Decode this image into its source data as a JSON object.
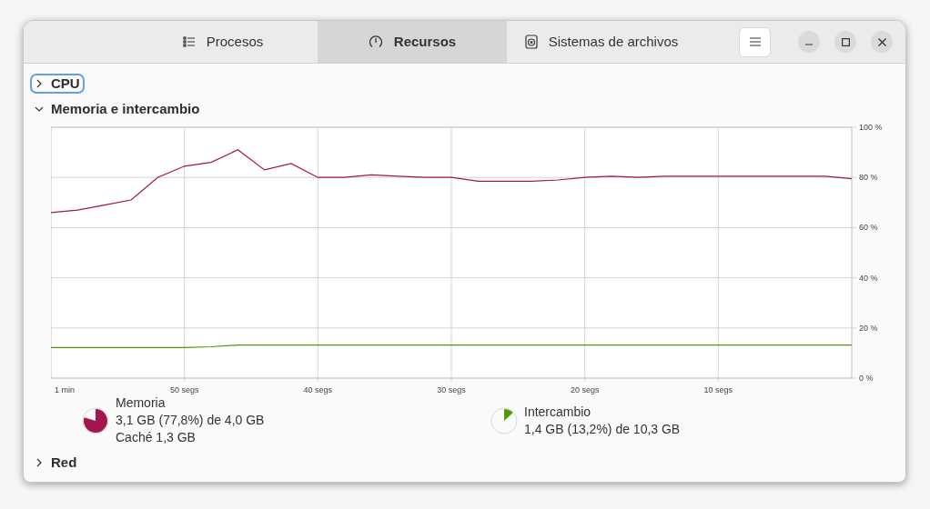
{
  "tabs": [
    {
      "label": "Procesos",
      "kind": "list",
      "selected": false
    },
    {
      "label": "Recursos",
      "kind": "gauge",
      "selected": true
    },
    {
      "label": "Sistemas de archivos",
      "kind": "disk",
      "selected": false
    }
  ],
  "sections": [
    {
      "title": "CPU",
      "expanded": false,
      "focused": true
    },
    {
      "title": "Memoria e intercambio",
      "expanded": true,
      "focused": false,
      "time_span": "1 min",
      "chart_data": {
        "type": "line",
        "grid": true,
        "xlim": [
          60,
          0
        ],
        "ylim": [
          0,
          100
        ],
        "x": [
          60,
          58,
          56,
          54,
          52,
          50,
          48,
          46,
          44,
          42,
          40,
          38,
          36,
          34,
          32,
          30,
          28,
          26,
          24,
          22,
          20,
          18,
          16,
          14,
          12,
          10,
          8,
          6,
          4,
          2,
          0
        ],
        "xticks": [
          {
            "value": 50,
            "label": "50 segs"
          },
          {
            "value": 40,
            "label": "40 segs"
          },
          {
            "value": 30,
            "label": "30 segs"
          },
          {
            "value": 20,
            "label": "20 segs"
          },
          {
            "value": 10,
            "label": "10 segs"
          }
        ],
        "yticks": [
          {
            "value": 0,
            "label": "0 %"
          },
          {
            "value": 20,
            "label": "20 %"
          },
          {
            "value": 40,
            "label": "40 %"
          },
          {
            "value": 60,
            "label": "60 %"
          },
          {
            "value": 80,
            "label": "80 %"
          },
          {
            "value": 100,
            "label": "100 %"
          }
        ],
        "series": [
          {
            "name": "Memoria",
            "color": "#a3154f",
            "values": [
              66,
              67,
              69,
              71,
              80,
              84.5,
              86,
              91,
              83,
              85.5,
              80,
              80,
              81,
              80.5,
              80,
              80,
              78.5,
              78.5,
              78.5,
              79,
              80,
              80.5,
              80,
              80.5,
              80.5,
              80.5,
              80.5,
              80.5,
              80.5,
              80.5,
              79.5
            ]
          },
          {
            "name": "Intercambio",
            "color": "#4e9a06",
            "values": [
              12.2,
              12.2,
              12.2,
              12.2,
              12.2,
              12.2,
              12.5,
              13.2,
              13.2,
              13.2,
              13.2,
              13.2,
              13.2,
              13.2,
              13.2,
              13.2,
              13.2,
              13.2,
              13.2,
              13.2,
              13.2,
              13.2,
              13.2,
              13.2,
              13.2,
              13.2,
              13.2,
              13.2,
              13.2,
              13.2,
              13.2
            ]
          }
        ]
      },
      "legend": [
        {
          "lines": [
            "3,1 GB (77,8%) de 4,0 GB",
            "Caché 1,3 GB"
          ]
        },
        {
          "lines": [
            "1,4 GB (13,2%) de 10,3 GB"
          ]
        }
      ]
    },
    {
      "title": "Red",
      "expanded": false,
      "focused": false
    }
  ]
}
